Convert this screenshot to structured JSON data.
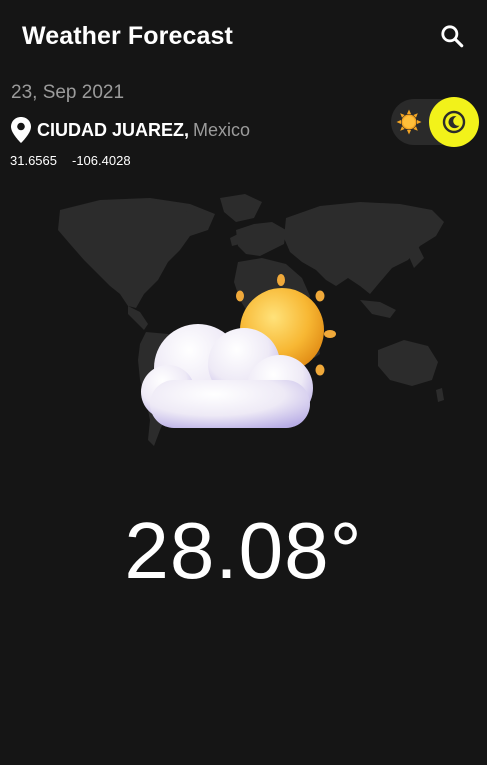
{
  "app_bar": {
    "title": "Weather Forecast",
    "search_icon": "search-icon"
  },
  "date": "23, Sep 2021",
  "location": {
    "icon": "location-pin-icon",
    "city": "CIUDAD JUAREZ",
    "separator": ",",
    "country": "Mexico"
  },
  "coordinates": {
    "lat": "31.6565",
    "lon": "-106.4028"
  },
  "theme_toggle": {
    "light_icon": "sun-icon",
    "dark_icon": "moon-icon",
    "selected": "dark",
    "accent_color": "#f2f21a"
  },
  "weather": {
    "icon": "partly-cloudy-icon",
    "temperature": "28.08°"
  },
  "colors": {
    "background": "#151515",
    "map": "#2c2c2c",
    "muted_text": "#9b9b9b"
  }
}
